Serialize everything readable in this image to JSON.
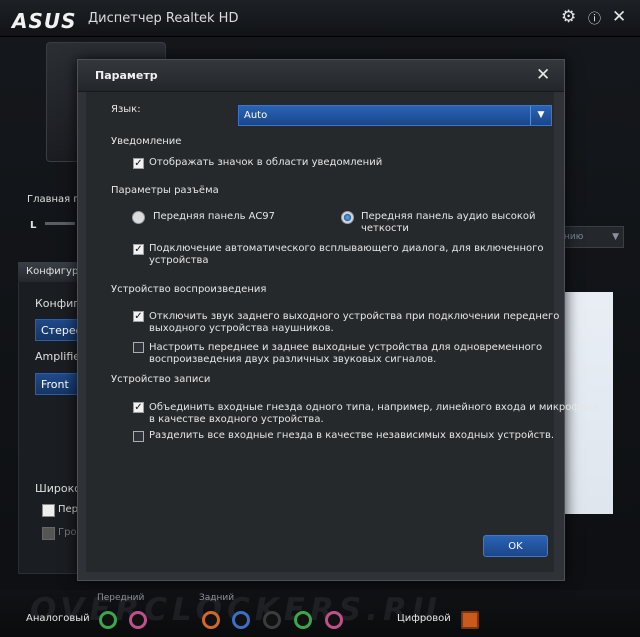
{
  "app": {
    "logo": "ASUS",
    "title": "Диспетчер Realtek HD"
  },
  "background": {
    "main_volume_label": "Главная гр",
    "slider_left": "L",
    "config_tab": "Конфигур",
    "config_label": "Конфигу",
    "config_value": "Стерео",
    "amplifier_label": "Amplifie",
    "amplifier_value": "Front Pa",
    "wide_label": "Широко",
    "wide_check": "Пер",
    "wide_check2": "Гро",
    "right_select": "нию"
  },
  "dialog": {
    "title": "Параметр",
    "language_label": "Язык:",
    "language_value": "Auto",
    "notification": {
      "heading": "Уведомление",
      "show_icon": "Отображать значок в области уведомлений"
    },
    "jack": {
      "heading": "Параметры разъёма",
      "ac97": "Передняя панель AC97",
      "hd_line1": "Передняя панель аудио высокой",
      "hd_line2": "четкости",
      "auto_popup_line1": "Подключение автоматического всплывающего диалога, для включенного",
      "auto_popup_line2": "устройства"
    },
    "playback": {
      "heading": "Устройство воспроизведения",
      "mute_rear_line1": "Отключить звук заднего выходного устройства при подключении переднего",
      "mute_rear_line2": "выходного устройства наушников.",
      "separate_line1": "Настроить переднее и заднее выходные устройства для одновременного",
      "separate_line2": "воспроизведения двух различных звуковых сигналов."
    },
    "recording": {
      "heading": "Устройство записи",
      "combine_line1": "Объединить входные гнезда одного типа, например, линейного входа и микрофона,",
      "combine_line2": "в качестве входного устройства.",
      "split": "Разделить все входные гнезда в качестве независимых входных устройств."
    },
    "ok": "OK"
  },
  "bottom": {
    "analog": "Аналоговый",
    "front": "Передний",
    "rear": "Задний",
    "digital": "Цифровой",
    "watermark": "OVERCLOCKERS.RU"
  },
  "state": {
    "show_icon": true,
    "ac97": false,
    "hd_audio": true,
    "auto_popup": true,
    "mute_rear": true,
    "separate": false,
    "combine": true,
    "split": false
  },
  "colors": {
    "accent": "#2458a4",
    "jack_green": "#3aa84a",
    "jack_pink": "#c0508c",
    "jack_orange": "#d0682e",
    "jack_blue": "#3b6fc8",
    "jack_black": "#2a2a2a"
  }
}
